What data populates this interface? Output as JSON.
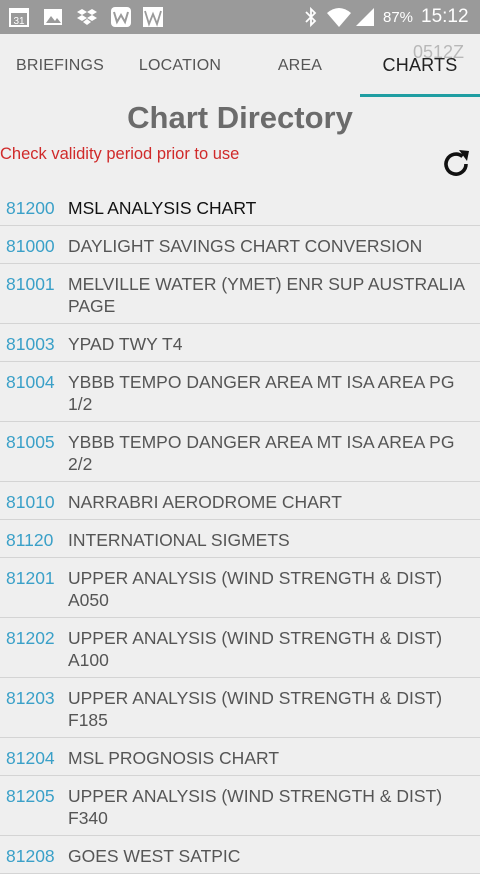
{
  "status_bar": {
    "calendar_day": "31",
    "battery": "87%",
    "clock": "15:12"
  },
  "tabs": [
    {
      "label": "BRIEFINGS"
    },
    {
      "label": "LOCATION"
    },
    {
      "label": "AREA"
    },
    {
      "label": "CHARTS"
    }
  ],
  "header_time": "0512Z",
  "title": "Chart Directory",
  "warning": "Check validity period prior to use",
  "colors": {
    "accent": "#1f9ea2",
    "code": "#3aa0c8",
    "warning": "#d02a2a"
  },
  "charts": [
    {
      "code": "81200",
      "name": "MSL ANALYSIS CHART"
    },
    {
      "code": "81000",
      "name": "DAYLIGHT SAVINGS CHART CONVERSION"
    },
    {
      "code": "81001",
      "name": "MELVILLE WATER (YMET) ENR SUP AUSTRALIA PAGE"
    },
    {
      "code": "81003",
      "name": "YPAD TWY T4"
    },
    {
      "code": "81004",
      "name": "YBBB TEMPO DANGER AREA MT ISA AREA PG 1/2"
    },
    {
      "code": "81005",
      "name": "YBBB TEMPO DANGER AREA MT ISA AREA PG 2/2"
    },
    {
      "code": "81010",
      "name": "NARRABRI AERODROME CHART"
    },
    {
      "code": "81120",
      "name": "INTERNATIONAL SIGMETS"
    },
    {
      "code": "81201",
      "name": "UPPER ANALYSIS (WIND STRENGTH & DIST) A050"
    },
    {
      "code": "81202",
      "name": "UPPER ANALYSIS (WIND STRENGTH & DIST) A100"
    },
    {
      "code": "81203",
      "name": "UPPER ANALYSIS (WIND STRENGTH & DIST) F185"
    },
    {
      "code": "81204",
      "name": "MSL PROGNOSIS CHART"
    },
    {
      "code": "81205",
      "name": "UPPER ANALYSIS (WIND STRENGTH & DIST) F340"
    },
    {
      "code": "81208",
      "name": "GOES WEST SATPIC"
    }
  ]
}
